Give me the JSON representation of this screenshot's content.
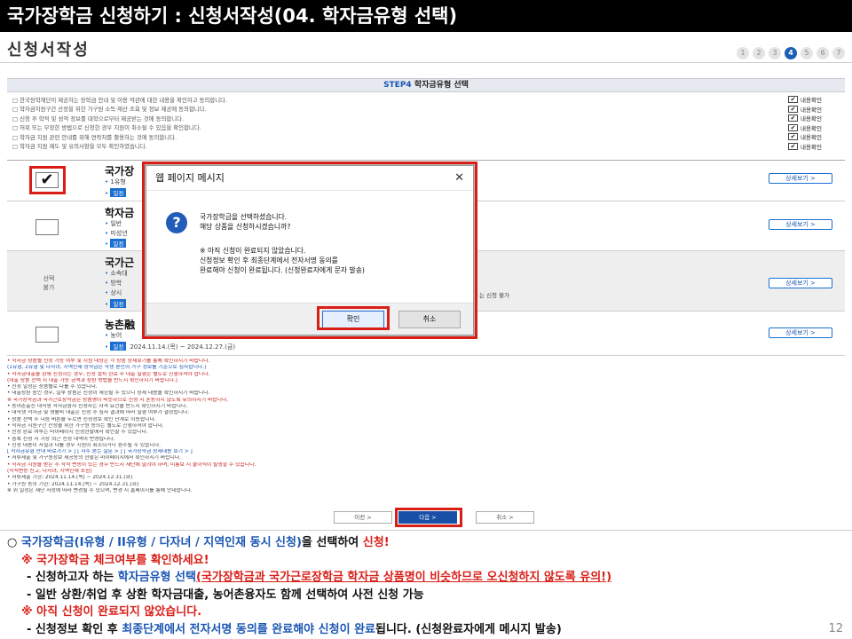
{
  "slide_title": "국가장학금 신청하기 : 신청서작성(04. 학자금유형 선택)",
  "page_heading": "신청서작성",
  "steps": [
    "1",
    "2",
    "3",
    "4",
    "5",
    "6",
    "7"
  ],
  "active_step": 4,
  "step_header": {
    "step": "STEP4",
    "label": "학자금유형 선택"
  },
  "agreements": [
    "□ 한국장학재단이 제공하는 장학금 안내 및 이용 약관에 대한 내용을 확인하고 동의합니다.",
    "□ 학자금지원구간 산정을 위한 가구원 소득·재산 조회 및 정보 제공에 동의합니다.",
    "□ 신청 후 학적 및 성적 정보를 대학으로부터 제공받는 것에 동의합니다.",
    "□ 허위 또는 부정한 방법으로 신청한 경우 지원이 취소될 수 있음을 확인합니다.",
    "□ 학자금 지원 관련 안내를 위해 연락처를 활용하는 것에 동의합니다.",
    "□ 학자금 지원 제도 및 유의사항을 모두 확인하였습니다."
  ],
  "agree_checks": [
    "내용확인",
    "내용확인",
    "내용확인",
    "내용확인",
    "내용확인",
    "내용확인"
  ],
  "products": [
    {
      "name": "국가장",
      "lines": [
        "1유형",
        "일정"
      ]
    },
    {
      "name": "학자금",
      "lines": [
        "일반",
        "미성년",
        "일정"
      ]
    },
    {
      "name": "국가근",
      "lines": [
        "소속대",
        "방학",
        "상시",
        "일정"
      ]
    },
    {
      "name": "농촌融",
      "lines": [
        "농어",
        "일정"
      ]
    }
  ],
  "product_period_badge": "일정",
  "last_period": "2024.11.14.(목) ~ 2024.12.27.(금)",
  "checked_mark": "✔",
  "unavailable_label": "선택\n불가",
  "side_note": "는 신청 불가",
  "detail_label": "상세보기 >",
  "dialog": {
    "title": "웹 페이지 메시지",
    "close_icon": "✕",
    "icon": "?",
    "messages": [
      "국가장학금을 선택하셨습니다.",
      "해당 상품을 신청하시겠습니까?",
      "",
      "※ 아직 신청이 완료되지 않았습니다.",
      "신청정보 확인 후 최종단계에서 전자서명 동의를",
      "완료해야 신청이 완료됩니다. (신청완료자에게 문자 발송)"
    ],
    "ok": "확인",
    "cancel": "취소"
  },
  "notes": [
    {
      "text": "• 학자금 상품별 신청 가능 여부 및 지원 대상은 각 상품 상세보기를 통해 확인하시기 바랍니다.",
      "color": "red"
    },
    {
      "text": "  (1유형, 2유형 및 다자녀, 지역인재 장학금은 학생 본인의 가구 정보를 기준으로 심사합니다.)",
      "color": "blue"
    },
    {
      "text": "• 학자금대출을 함께 신청하는 경우, 신청 절차 완료 후 대출 실행은 별도로 진행하셔야 합니다.",
      "color": "red"
    },
    {
      "text": "  (대출 상품 선택 시 대출 가능 금액과 상환 방법을 반드시 확인하시기 바랍니다.)",
      "color": "red"
    },
    {
      "text": "• 신청 일정은 상품별로 다를 수 있습니다.",
      "color": "gray"
    },
    {
      "text": "• 대출상환 중인 경우, 일부 상품은 신청이 제한될 수 있으니 상세 내용을 확인하시기 바랍니다.",
      "color": "gray"
    },
    {
      "text": "※ 국가장학금과 국가근로장학금은 상품명이 비슷하므로 신청 시 혼동하지 않도록 유의하시기 바랍니다.",
      "color": "red"
    },
    {
      "text": "• 농어촌출신 대학생 학자금융자 신청자는 자격 요건을 반드시 확인하시기 바랍니다.",
      "color": "gray"
    },
    {
      "text": "• 대학생 학자금 및 생활비 대출은 신청 후 심사 결과에 따라 실행 여부가 결정됩니다.",
      "color": "gray"
    },
    {
      "text": "• 상품 선택 후 다음 버튼을 누르면 신청정보 확인 단계로 이동합니다.",
      "color": "gray"
    },
    {
      "text": "• 학자금 지원구간 산정을 위한 가구원 동의는 별도로 진행하셔야 합니다.",
      "color": "gray"
    },
    {
      "text": "• 신청 완료 여부는 마이페이지 신청현황에서 확인할 수 있습니다.",
      "color": "gray"
    },
    {
      "text": "• 중복 신청 시 가장 최근 신청 내역이 반영됩니다.",
      "color": "gray"
    },
    {
      "text": "• 신청 내용이 사실과 다를 경우 지원이 취소되거나 환수될 수 있습니다.",
      "color": "gray"
    },
    {
      "text": "[ 학자금유형 안내 바로가기 > ]   [ 자주 묻는 질문 > ]   [ 국가장학금 상세내용 보기 > ]",
      "color": "blue"
    },
    {
      "text": "• 서류제출 및 가구원정보 제공동의 현황은 마이페이지에서 확인하시기 바랍니다.",
      "color": "gray"
    },
    {
      "text": "• 학자금 지원을 받은 후 학적 변동이 있는 경우 반드시 재단에 알려야 하며, 미통보 시 불이익이 발생할 수 있습니다.",
      "color": "red"
    },
    {
      "text": "  (학적변동 신고, 다자녀, 지역인재 포함)",
      "color": "red"
    },
    {
      "text": "• 서류제출 기한: 2024.11.14.(목) ~ 2024.12.31.(화)",
      "color": "gray"
    },
    {
      "text": "• 가구원 동의 기한: 2024.11.14.(목) ~ 2024.12.31.(화)",
      "color": "gray"
    },
    {
      "text": "※ 위 일정은 재단 사정에 따라 변경될 수 있으며, 변경 시 홈페이지를 통해 안내합니다.",
      "color": "gray"
    }
  ],
  "bottom_buttons": {
    "prev": "이전 >",
    "next": "다음 >",
    "cancel": "취소 >"
  },
  "explanation": {
    "line1": {
      "a": "○ ",
      "b": "국가장학금(I유형 / II유형 / 다자녀 / 지역인재 동시 신청)",
      "c": "을 선택하여 ",
      "d": "신청!"
    },
    "line2": "※ 국가장학금 체크여부를 확인하세요!",
    "line3": {
      "a": "- 신청하고자 하는 ",
      "b": "학자금유형 선택",
      "c": "(국가장학금과 국가근로장학금 학자금 상품명이 비슷하므로 오신청하지 않도록 유의!)"
    },
    "line4": "- 일반 상환/취업 후 상환 학자금대출, 농어촌융자도 함께 선택하여 사전 신청 가능",
    "line5": "※ 아직 신청이 완료되지 않았습니다.",
    "line6": {
      "a": "- 신청정보 확인 후 ",
      "b": "최종단계에서 전자서명 동의를 완료해야 신청이 완료",
      "c": "됩니다. (신청완료자에게 메시지 발송)"
    }
  },
  "page_number": "12",
  "colors": {
    "brand_blue": "#1a56b3",
    "highlight_red": "#d91e18"
  }
}
